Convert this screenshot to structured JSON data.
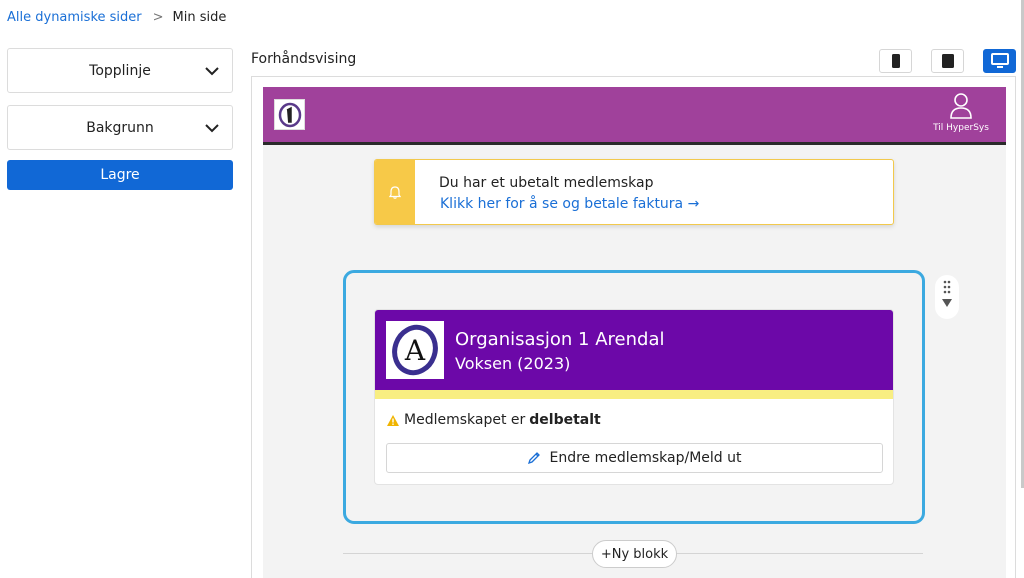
{
  "breadcrumb": {
    "parent": "Alle dynamiske sider",
    "separator": ">",
    "current": "Min side"
  },
  "sidebar": {
    "dropdowns": [
      {
        "label": "Topplinje"
      },
      {
        "label": "Bakgrunn"
      }
    ],
    "save_label": "Lagre"
  },
  "preview": {
    "title": "Forhåndsvising",
    "devices": [
      {
        "name": "mobile",
        "active": false
      },
      {
        "name": "tablet",
        "active": false
      },
      {
        "name": "desktop",
        "active": true
      }
    ],
    "topbar": {
      "color": "#a0419b",
      "user_link": "Til HyperSys"
    },
    "notice": {
      "title": "Du har et ubetalt medlemskap",
      "link": "Klikk her for å se og betale faktura →"
    },
    "membership": {
      "org_name": "Organisasjon 1 Arendal",
      "subtitle": "Voksen (2023)",
      "status_prefix": "Medlemskapet er",
      "status_value": "delbetalt",
      "edit_label": "Endre medlemskap/Meld ut"
    },
    "new_block_label": "+Ny blokk"
  },
  "colors": {
    "accent": "#1168d6",
    "header_purple": "#6c08a8",
    "selection_blue": "#3ba9e0",
    "notice_yellow": "#f7c948"
  }
}
